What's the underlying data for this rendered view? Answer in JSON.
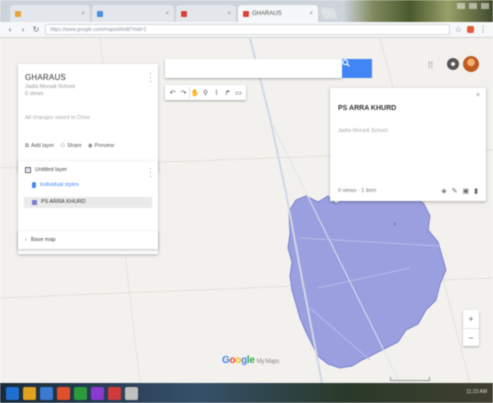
{
  "browser": {
    "tabs": [
      {
        "label": "",
        "favicon_color": "#e8a33c"
      },
      {
        "label": "",
        "favicon_color": "#4a8fe0"
      },
      {
        "label": "",
        "favicon_color": "#d9443a"
      },
      {
        "label": "GHARAUS",
        "favicon_color": "#d9443a"
      }
    ],
    "url": "https://www.google.com/maps/d/edit?mid=1"
  },
  "map": {
    "search": {
      "placeholder": ""
    },
    "colors": {
      "polygon": "#9a9fe0",
      "road": "#cfd8e6",
      "accent": "#4285f4"
    }
  },
  "panel": {
    "title": "GHARAUS",
    "subtitle_1": "Jadia Moradi School",
    "subtitle_2": "0 views",
    "description": "All changes saved to Drive",
    "actions": [
      {
        "icon": "add-layer-icon",
        "label": "Add layer"
      },
      {
        "icon": "share-icon",
        "label": "Share"
      },
      {
        "icon": "preview-icon",
        "label": "Preview"
      }
    ],
    "layer": {
      "name": "Untitled layer",
      "style_link": "Individual styles",
      "feature": "PS ARRA KHURD"
    },
    "base_map": "Base map"
  },
  "card": {
    "title": "PS ARRA KHURD",
    "subtitle": "Jadia Moradi School",
    "footer": "0 views · 1 item"
  },
  "logo": {
    "g1": "G",
    "g2": "o",
    "g3": "o",
    "g4": "g",
    "rest": "le",
    "suffix": "My Maps"
  },
  "zoom": {
    "in": "+",
    "out": "−"
  },
  "taskbar": {
    "time": "11:23 AM",
    "icons": [
      "#1f6fd0",
      "#e0a020",
      "#3a7ad0",
      "#e0502a",
      "#2a9a3a",
      "#8a3ad0",
      "#d03a3a",
      "#c0c0c0"
    ]
  }
}
